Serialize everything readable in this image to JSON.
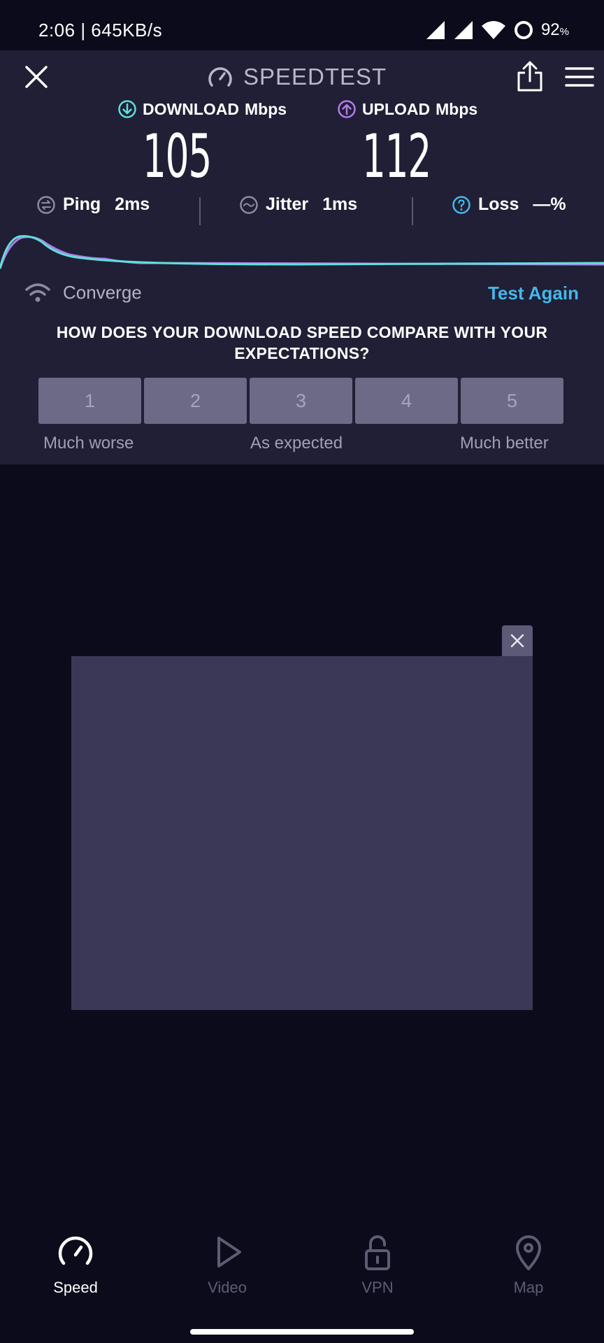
{
  "status_bar": {
    "time": "2:06 | 645KB/s",
    "battery": "92",
    "battery_unit": "%"
  },
  "header": {
    "title": "SPEEDTEST"
  },
  "results": {
    "download_label": "DOWNLOAD",
    "download_unit": "Mbps",
    "download_value": "105",
    "upload_label": "UPLOAD",
    "upload_unit": "Mbps",
    "upload_value": "112",
    "ping_label": "Ping",
    "ping_value": "2ms",
    "jitter_label": "Jitter",
    "jitter_value": "1ms",
    "loss_label": "Loss",
    "loss_value": "—%"
  },
  "isp_name": "Converge",
  "test_again_label": "Test Again",
  "rating": {
    "question": "HOW DOES YOUR DOWNLOAD SPEED COMPARE WITH YOUR EXPECTATIONS?",
    "options": [
      "1",
      "2",
      "3",
      "4",
      "5"
    ],
    "label_low": "Much worse",
    "label_mid": "As expected",
    "label_high": "Much better"
  },
  "nav": {
    "speed": "Speed",
    "video": "Video",
    "vpn": "VPN",
    "map": "Map"
  },
  "colors": {
    "download_accent": "#5ee0d8",
    "upload_accent": "#b07ce8",
    "link_blue": "#44b7ea",
    "panel_bg": "#201f35",
    "page_bg": "#0c0b1b"
  }
}
